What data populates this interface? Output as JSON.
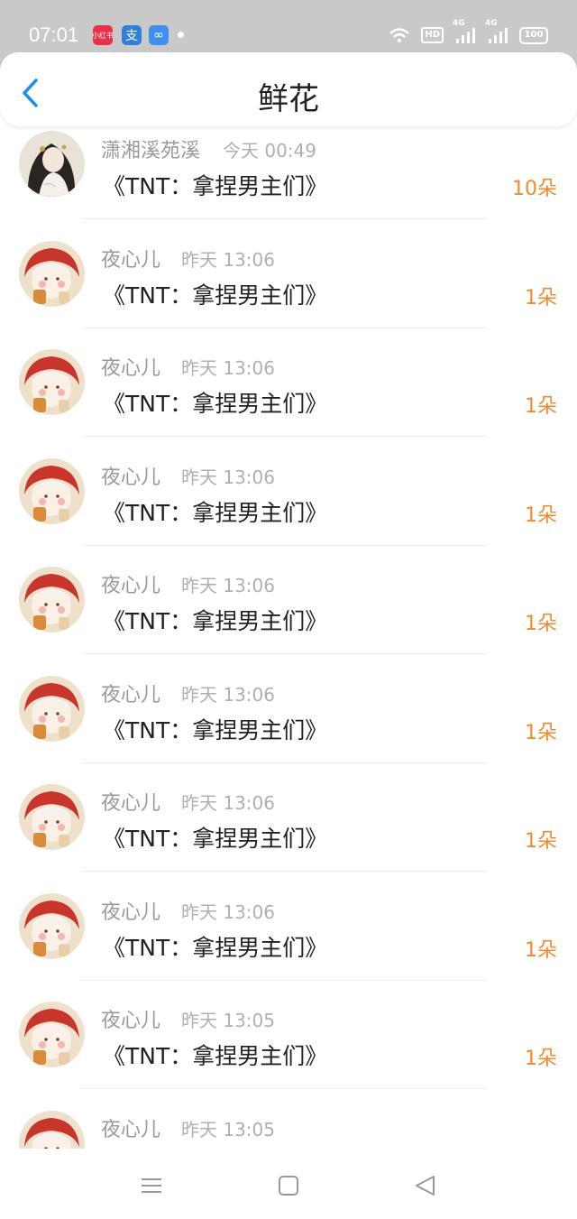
{
  "status_bar": {
    "time": "07:01",
    "app_icons": [
      "小红书",
      "支",
      "∞"
    ],
    "hd": "HD",
    "network_1": "4G",
    "network_2": "4G",
    "battery": "100"
  },
  "header": {
    "title": "鲜花",
    "back_icon": "chevron-left-icon"
  },
  "accent_color": "#f08a30",
  "records": [
    {
      "name": "潇湘溪苑溪",
      "time": "今天 00:49",
      "book": "《TNT：拿捏男主们》",
      "count": "10朵",
      "avatar": "girl-illustration"
    },
    {
      "name": "夜心儿",
      "time": "昨天 13:06",
      "book": "《TNT：拿捏男主们》",
      "count": "1朵",
      "avatar": "chibi-red-hat"
    },
    {
      "name": "夜心儿",
      "time": "昨天 13:06",
      "book": "《TNT：拿捏男主们》",
      "count": "1朵",
      "avatar": "chibi-red-hat"
    },
    {
      "name": "夜心儿",
      "time": "昨天 13:06",
      "book": "《TNT：拿捏男主们》",
      "count": "1朵",
      "avatar": "chibi-red-hat"
    },
    {
      "name": "夜心儿",
      "time": "昨天 13:06",
      "book": "《TNT：拿捏男主们》",
      "count": "1朵",
      "avatar": "chibi-red-hat"
    },
    {
      "name": "夜心儿",
      "time": "昨天 13:06",
      "book": "《TNT：拿捏男主们》",
      "count": "1朵",
      "avatar": "chibi-red-hat"
    },
    {
      "name": "夜心儿",
      "time": "昨天 13:06",
      "book": "《TNT：拿捏男主们》",
      "count": "1朵",
      "avatar": "chibi-red-hat"
    },
    {
      "name": "夜心儿",
      "time": "昨天 13:06",
      "book": "《TNT：拿捏男主们》",
      "count": "1朵",
      "avatar": "chibi-red-hat"
    },
    {
      "name": "夜心儿",
      "time": "昨天 13:05",
      "book": "《TNT：拿捏男主们》",
      "count": "1朵",
      "avatar": "chibi-red-hat"
    },
    {
      "name": "夜心儿",
      "time": "昨天 13:05",
      "book": "",
      "count": "",
      "avatar": "chibi-red-hat"
    }
  ],
  "nav_bar": {
    "menu_icon": "menu-icon",
    "home_icon": "home-square-icon",
    "back_icon": "back-triangle-icon"
  }
}
